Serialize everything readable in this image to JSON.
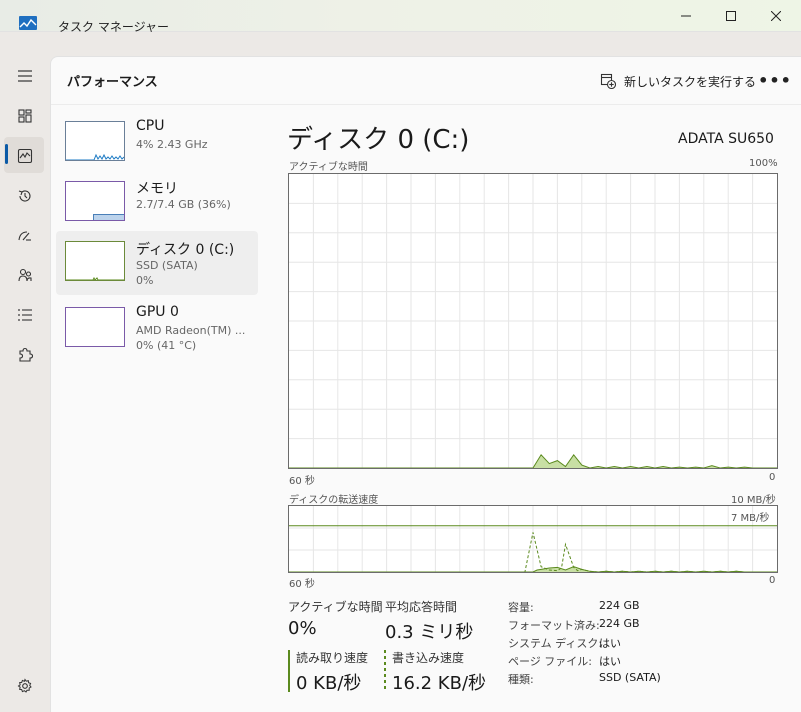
{
  "window": {
    "title": "タスク マネージャー"
  },
  "header": {
    "title": "パフォーマンス",
    "new_task_label": "新しいタスクを実行する",
    "more_label": "•••"
  },
  "colors": {
    "accent": "#0b5aa6",
    "disk_line": "#5b8a1e",
    "disk_fill": "#c8dfa4",
    "cpu_line": "#1e7bc4",
    "gpu_line": "#8a4ec9"
  },
  "devices": [
    {
      "name": "CPU",
      "sub1": "4%  2.43 GHz",
      "sub2": ""
    },
    {
      "name": "メモリ",
      "sub1": "2.7/7.4 GB (36%)",
      "sub2": ""
    },
    {
      "name": "ディスク 0 (C:)",
      "sub1": "SSD (SATA)",
      "sub2": "0%"
    },
    {
      "name": "GPU 0",
      "sub1": "AMD Radeon(TM) ...",
      "sub2": "0%  (41 °C)"
    }
  ],
  "memory_thumb": {
    "usage_fraction": 0.36
  },
  "disk": {
    "title": "ディスク 0 (C:)",
    "model": "ADATA SU650",
    "active_time_label": "アクティブな時間",
    "active_time_max": "100%",
    "transfer_label": "ディスクの転送速度",
    "transfer_max": "10 MB/秒",
    "transfer_ref": "7 MB/秒",
    "x_left": "60 秒",
    "x_right": "0"
  },
  "chart_data": [
    {
      "type": "area",
      "title": "アクティブな時間",
      "xlabel": "",
      "ylabel": "",
      "x_range": [
        60,
        0
      ],
      "ylim": [
        0,
        100
      ],
      "grid": true,
      "series": [
        {
          "x": [
            60,
            30,
            29,
            28,
            27,
            26,
            25,
            24,
            23,
            22,
            21,
            20,
            19,
            18,
            17,
            16,
            15,
            14,
            13,
            12,
            11,
            10,
            9,
            8,
            7,
            6,
            5,
            4,
            3,
            2,
            0
          ],
          "values": [
            0,
            0,
            4.5,
            1.5,
            2.5,
            0.5,
            4.5,
            1,
            0,
            0.5,
            0,
            0.5,
            0,
            0.5,
            0,
            0.5,
            0,
            0.5,
            0,
            0.3,
            0,
            0.3,
            0,
            0.8,
            0,
            0.3,
            0,
            0.3,
            0,
            0,
            0
          ]
        }
      ]
    },
    {
      "type": "line",
      "title": "ディスクの転送速度",
      "xlabel": "",
      "ylabel": "",
      "x_range": [
        60,
        0
      ],
      "ylim": [
        0,
        10
      ],
      "grid": true,
      "reference_line": 7,
      "series": [
        {
          "x": [
            60,
            30,
            29.5,
            29,
            28,
            27,
            26,
            25,
            24,
            23,
            22,
            21,
            20,
            19,
            18,
            17,
            16,
            15,
            14,
            13,
            12,
            11,
            10,
            9,
            8,
            7,
            6,
            5,
            4,
            3,
            2,
            0
          ],
          "values": [
            0,
            0,
            0.3,
            0.4,
            0.6,
            0.7,
            0.3,
            0.8,
            0.4,
            0.1,
            0,
            0.1,
            0,
            0.1,
            0,
            0.1,
            0,
            0.1,
            0,
            0.1,
            0,
            0.1,
            0,
            0.1,
            0,
            0.1,
            0,
            0.1,
            0,
            0,
            0,
            0
          ]
        },
        {
          "x": [
            60,
            31,
            30,
            29,
            28,
            27,
            26.5,
            26,
            25,
            24.5,
            24,
            23,
            22,
            21,
            20,
            19,
            18,
            17,
            16,
            15,
            14,
            13,
            12,
            11,
            10,
            9,
            8,
            7,
            6,
            5,
            4,
            3,
            2,
            0
          ],
          "values": [
            0,
            0,
            6,
            0.8,
            0.3,
            0.2,
            0.6,
            4.2,
            0.7,
            0.2,
            0.4,
            0.1,
            0,
            0.1,
            0,
            0.1,
            0,
            0.1,
            0,
            0.1,
            0,
            0.1,
            0,
            0.1,
            0,
            0.1,
            0,
            0.1,
            0,
            0.1,
            0,
            0,
            0,
            0
          ]
        }
      ]
    }
  ],
  "stats": {
    "active_time": {
      "label": "アクティブな時間",
      "value": "0%"
    },
    "avg_response": {
      "label": "平均応答時間",
      "value": "0.3 ミリ秒"
    },
    "read_speed": {
      "label": "読み取り速度",
      "value": "0 KB/秒"
    },
    "write_speed": {
      "label": "書き込み速度",
      "value": "16.2 KB/秒"
    }
  },
  "properties": [
    {
      "key": "容量:",
      "value": "224 GB"
    },
    {
      "key": "フォーマット済み:",
      "value": "224 GB"
    },
    {
      "key": "システム ディスク:",
      "value": "はい"
    },
    {
      "key": "ページ ファイル:",
      "value": "はい"
    },
    {
      "key": "種類:",
      "value": "SSD (SATA)"
    }
  ]
}
